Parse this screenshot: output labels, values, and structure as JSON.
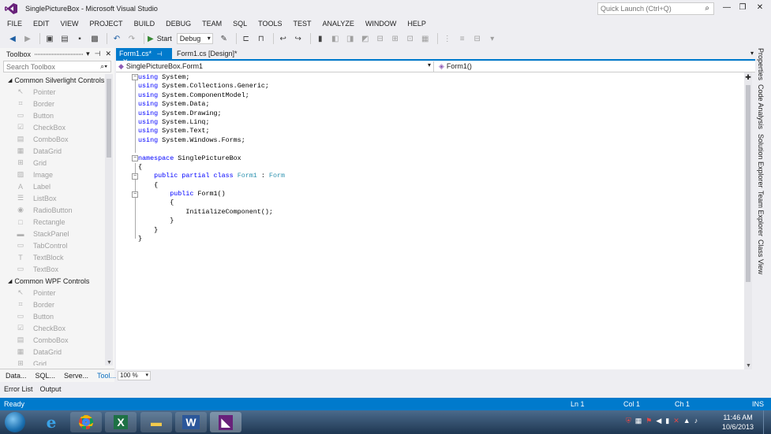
{
  "window": {
    "title": "SinglePictureBox - Microsoft Visual Studio",
    "quick_launch_placeholder": "Quick Launch (Ctrl+Q)",
    "controls": {
      "minimize": "—",
      "maximize": "❐",
      "close": "✕"
    }
  },
  "menu": [
    "FILE",
    "EDIT",
    "VIEW",
    "PROJECT",
    "BUILD",
    "DEBUG",
    "TEAM",
    "SQL",
    "TOOLS",
    "TEST",
    "ANALYZE",
    "WINDOW",
    "HELP"
  ],
  "toolbar": {
    "start_label": "Start",
    "configuration": "Debug"
  },
  "toolbox": {
    "title": "Toolbox",
    "search_placeholder": "Search Toolbox",
    "groups": [
      {
        "name": "Common Silverlight Controls",
        "items": [
          {
            "label": "Pointer",
            "icon": "pointer-icon",
            "glyph": "↖"
          },
          {
            "label": "Border",
            "icon": "border-icon",
            "glyph": "⌗"
          },
          {
            "label": "Button",
            "icon": "button-icon",
            "glyph": "▭"
          },
          {
            "label": "CheckBox",
            "icon": "checkbox-icon",
            "glyph": "☑"
          },
          {
            "label": "ComboBox",
            "icon": "combobox-icon",
            "glyph": "▤"
          },
          {
            "label": "DataGrid",
            "icon": "datagrid-icon",
            "glyph": "▦"
          },
          {
            "label": "Grid",
            "icon": "grid-icon",
            "glyph": "⊞"
          },
          {
            "label": "Image",
            "icon": "image-icon",
            "glyph": "▨"
          },
          {
            "label": "Label",
            "icon": "label-icon",
            "glyph": "A"
          },
          {
            "label": "ListBox",
            "icon": "listbox-icon",
            "glyph": "☰"
          },
          {
            "label": "RadioButton",
            "icon": "radiobutton-icon",
            "glyph": "◉"
          },
          {
            "label": "Rectangle",
            "icon": "rectangle-icon",
            "glyph": "□"
          },
          {
            "label": "StackPanel",
            "icon": "stackpanel-icon",
            "glyph": "▬"
          },
          {
            "label": "TabControl",
            "icon": "tabcontrol-icon",
            "glyph": "▭"
          },
          {
            "label": "TextBlock",
            "icon": "textblock-icon",
            "glyph": "T"
          },
          {
            "label": "TextBox",
            "icon": "textbox-icon",
            "glyph": "▭"
          }
        ]
      },
      {
        "name": "Common WPF Controls",
        "items": [
          {
            "label": "Pointer",
            "icon": "pointer-icon",
            "glyph": "↖"
          },
          {
            "label": "Border",
            "icon": "border-icon",
            "glyph": "⌗"
          },
          {
            "label": "Button",
            "icon": "button-icon",
            "glyph": "▭"
          },
          {
            "label": "CheckBox",
            "icon": "checkbox-icon",
            "glyph": "☑"
          },
          {
            "label": "ComboBox",
            "icon": "combobox-icon",
            "glyph": "▤"
          },
          {
            "label": "DataGrid",
            "icon": "datagrid-icon",
            "glyph": "▦"
          },
          {
            "label": "Grid",
            "icon": "grid-icon",
            "glyph": "⊞"
          }
        ]
      }
    ],
    "bottom_tabs": [
      "Data...",
      "SQL...",
      "Serve...",
      "Tool..."
    ]
  },
  "editor": {
    "tabs": [
      {
        "label": "Form1.cs*",
        "active": true
      },
      {
        "label": "Form1.cs [Design]*",
        "active": false
      }
    ],
    "nav_left": "SinglePictureBox.Form1",
    "nav_right": "Form1()",
    "zoom": "100 %",
    "code_lines": [
      "using System;",
      "using System.Collections.Generic;",
      "using System.ComponentModel;",
      "using System.Data;",
      "using System.Drawing;",
      "using System.Linq;",
      "using System.Text;",
      "using System.Windows.Forms;",
      "",
      "namespace SinglePictureBox",
      "{",
      "    public partial class Form1 : Form",
      "    {",
      "        public Form1()",
      "        {",
      "            InitializeComponent();",
      "        }",
      "    }",
      "}"
    ]
  },
  "right_tabs": [
    "Properties",
    "Code Analysis",
    "Solution Explorer",
    "Team Explorer",
    "Class View"
  ],
  "bottom_panel_tabs": [
    "Error List",
    "Output"
  ],
  "status": {
    "left": "Ready",
    "line": "Ln 1",
    "col": "Col 1",
    "ch": "Ch 1",
    "mode": "INS"
  },
  "taskbar": {
    "time": "11:46 AM",
    "date": "10/6/2013"
  },
  "colors": {
    "accent": "#007acc",
    "keyword": "#0000ff",
    "type": "#2b91af"
  }
}
